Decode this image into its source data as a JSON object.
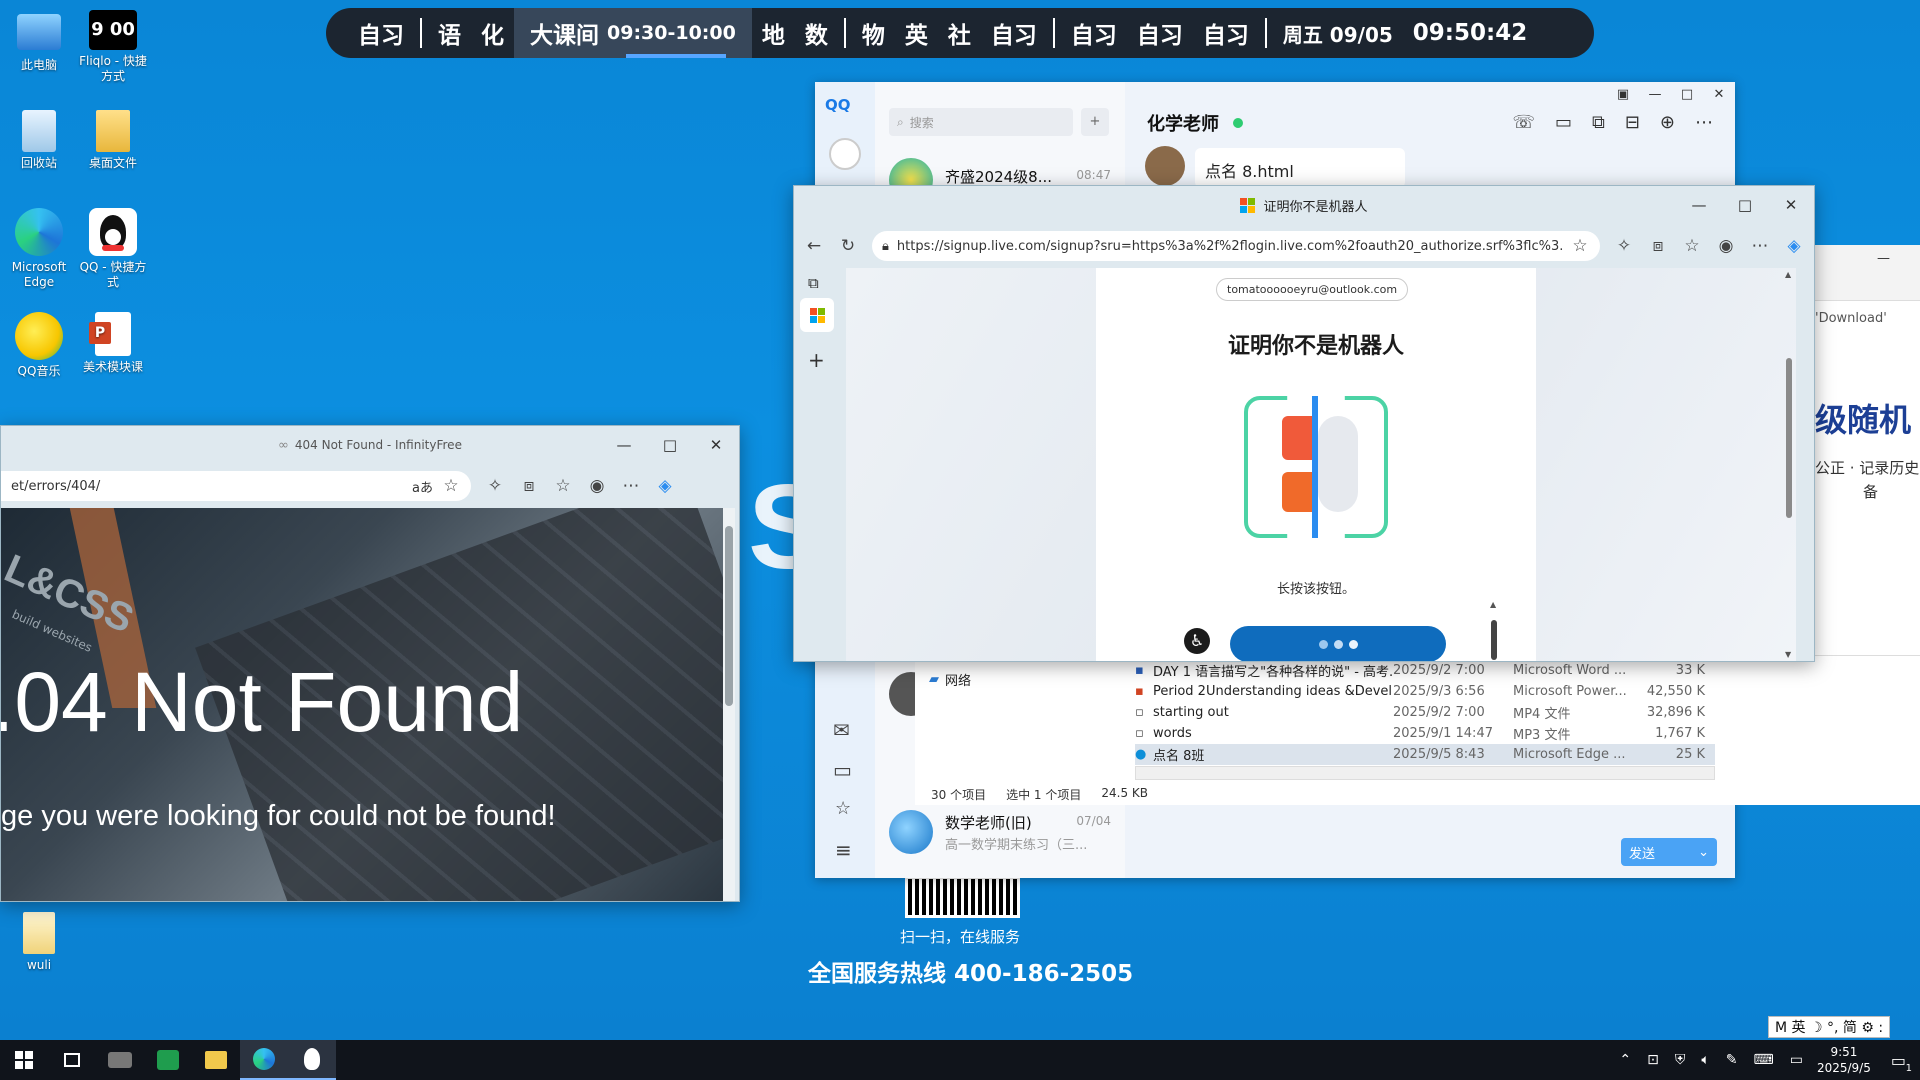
{
  "desktop": {
    "icons": [
      {
        "label": "此电脑"
      },
      {
        "label": "Fliqlo - 快捷方式"
      },
      {
        "label": "回收站"
      },
      {
        "label": "桌面文件"
      },
      {
        "label": "Microsoft Edge"
      },
      {
        "label": "QQ - 快捷方式"
      },
      {
        "label": "QQ音乐"
      },
      {
        "label": "美术模块课"
      },
      {
        "label": "wuli"
      }
    ],
    "fliqlo_time": "9 00",
    "qr_caption": "扫一扫，在线服务",
    "hotline": "全国服务热线 400-186-2505",
    "bg_letter": "S"
  },
  "schedule": {
    "items": [
      "自习",
      "语",
      "化",
      "大课间",
      "09:30-10:00",
      "地",
      "数",
      "物",
      "英",
      "社",
      "自习",
      "自习",
      "自习",
      "自习"
    ],
    "day_date": "周五 09/05",
    "time": "09:50:42"
  },
  "qq": {
    "logo": "QQ",
    "search_placeholder": "搜索",
    "contacts": [
      {
        "name": "齐盛2024级8...",
        "time": "08:47",
        "preview": ""
      },
      {
        "name": "数学老师(旧)",
        "time": "07/04",
        "preview": "高一数学期末练习（三..."
      }
    ],
    "chat_title": "化学老师",
    "file_name": "点名 8.html",
    "send_label": "发送"
  },
  "explorer": {
    "nav_item": "网络",
    "files": [
      {
        "name": "DAY 1 语言描写之\"各种各样的说\" - 高考...",
        "date": "2025/9/2 7:00",
        "type": "Microsoft Word ...",
        "size": "33 K"
      },
      {
        "name": "Period 2Understanding ideas &Devel...",
        "date": "2025/9/3 6:56",
        "type": "Microsoft Power...",
        "size": "42,550 K"
      },
      {
        "name": "starting out",
        "date": "2025/9/2 7:00",
        "type": "MP4 文件",
        "size": "32,896 K"
      },
      {
        "name": "words",
        "date": "2025/9/1 14:47",
        "type": "MP3 文件",
        "size": "1,767 K"
      },
      {
        "name": "点名 8班",
        "date": "2025/9/5 8:43",
        "type": "Microsoft Edge ...",
        "size": "25 K"
      }
    ],
    "status": {
      "count": "30 个项目",
      "selected": "选中 1 个项目",
      "size": "24.5 KB"
    }
  },
  "right_window": {
    "download_text": "'Download'",
    "heading": "级随机",
    "sub1": "公正 · 记录历史",
    "sub2": "备"
  },
  "edge_main": {
    "title": "证明你不是机器人",
    "url": "https://signup.live.com/signup?sru=https%3a%2f%2flogin.live.com%2foauth20_authorize.srf%3flc%3...",
    "email": "tomatoooooeyru@outlook.com",
    "heading": "证明你不是机器人",
    "instruction": "长按该按钮。"
  },
  "edge_404": {
    "title": "404 Not Found - InfinityFree",
    "url": "et/errors/404/",
    "read_aloud": "aあ",
    "heading": ".04 Not Found",
    "subtext": "ge you were looking for could not be found!",
    "bg_text": "L&CSS",
    "bg_sub": "build websites"
  },
  "taskbar": {
    "ime": "M 英 ☽ °, 简 ⚙ :",
    "time": "9:51",
    "date": "2025/9/5",
    "notif": "1"
  },
  "colors": {
    "desktop_bg": "#0c8fe0",
    "schedule_bg": "#1c2530",
    "accent": "#0067c0",
    "online": "#2ecc71"
  }
}
